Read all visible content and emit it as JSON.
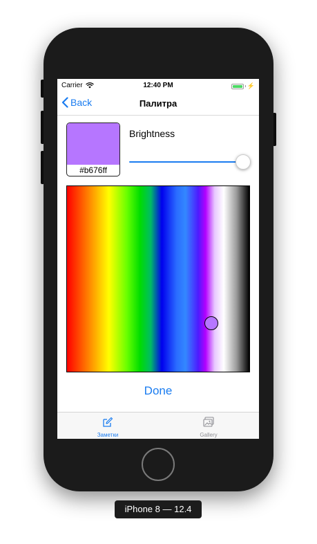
{
  "status_bar": {
    "carrier": "Carrier",
    "time": "12:40 PM",
    "wifi_icon": "wifi-icon",
    "battery_icon": "battery-charging-icon",
    "battery_level": 1.0,
    "battery_color": "#4cd964"
  },
  "nav": {
    "back_label": "Back",
    "back_icon": "chevron-left-icon",
    "title": "Палитра"
  },
  "color_preview": {
    "hex_label": "#b676ff",
    "color": "#b676ff"
  },
  "brightness": {
    "label": "Brightness",
    "value": 1.0
  },
  "palette": {
    "picker_fraction_x": 0.79,
    "picker_fraction_y": 0.74,
    "picker_color": "#b676ff"
  },
  "done_label": "Done",
  "tab_bar": {
    "tabs": [
      {
        "label": "Заметки",
        "icon": "pencil-edit-icon",
        "selected": true,
        "color": "#1a7cf0"
      },
      {
        "label": "Gallery",
        "icon": "photos-icon",
        "selected": false,
        "color": "#8e8e93"
      }
    ]
  },
  "device_label": "iPhone 8 — 12.4",
  "accent_color": "#1a7cf0"
}
